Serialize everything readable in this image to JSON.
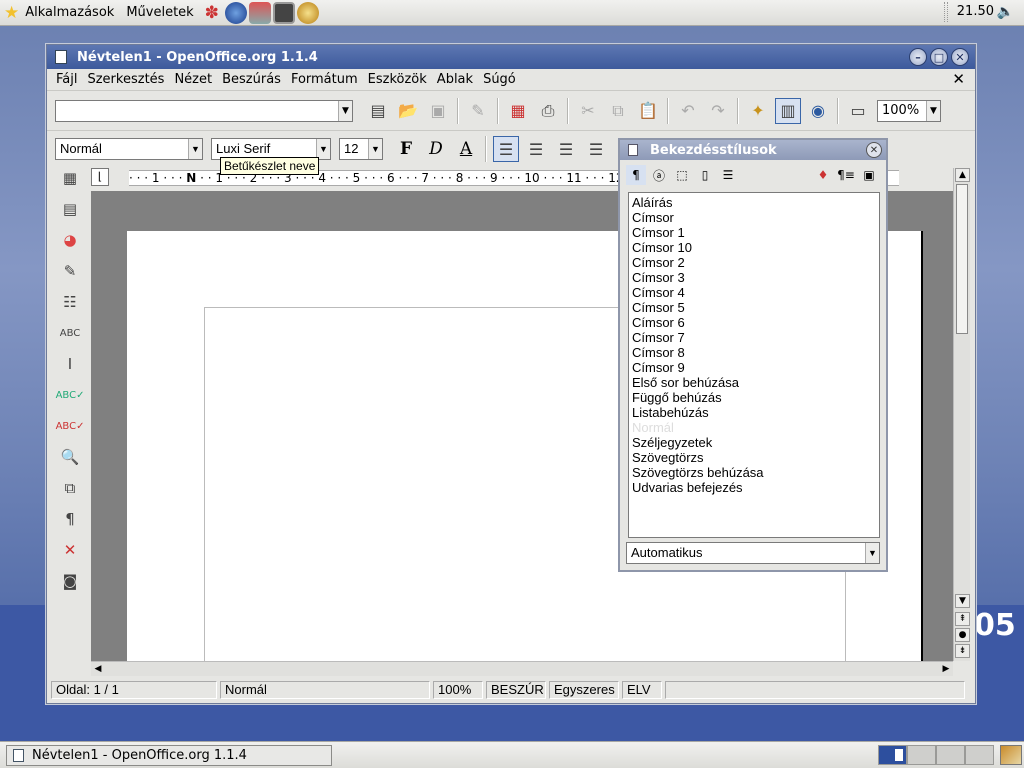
{
  "topbar": {
    "menu_apps": "Alkalmazások",
    "menu_actions": "Műveletek",
    "clock": "21.50"
  },
  "window": {
    "title": "Névtelen1 - OpenOffice.org 1.1.4",
    "menu": [
      "Fájl",
      "Szerkesztés",
      "Nézet",
      "Beszúrás",
      "Formátum",
      "Eszközök",
      "Ablak",
      "Súgó"
    ],
    "url_value": "",
    "zoom": "100%",
    "paragraph_style": "Normál",
    "font_name": "Luxi Serif",
    "font_size": "12",
    "bold_label": "F",
    "italic_label": "D",
    "underline_label": "A",
    "tooltip": "Betűkészlet neve",
    "ruler_text": "· · · 1 · · · 𝝢 · · 1 · · · 2 · · · 3 · · · 4 · · · 5 · · · 6 · · · 7 · · · 8 · · · 9 · · · 10 · · · 11 · · · 12 · · · 13 · · · 14 · · · 15 · · · 16 · · · 17 · · · 18 ·"
  },
  "status": {
    "page": "Oldal: 1 / 1",
    "style": "Normál",
    "zoom": "100%",
    "mode": "BESZÚR",
    "selection": "Egyszeres",
    "elv": "ELV"
  },
  "stylist": {
    "title": "Bekezdésstílusok",
    "items": [
      "Aláírás",
      "Címsor",
      "Címsor 1",
      "Címsor 10",
      "Címsor 2",
      "Címsor 3",
      "Címsor 4",
      "Címsor 5",
      "Címsor 6",
      "Címsor 7",
      "Címsor 8",
      "Címsor 9",
      "Első sor behúzása",
      "Függő behúzás",
      "Listabehúzás",
      "Normál",
      "Széljegyzetek",
      "Szövegtörzs",
      "Szövegtörzs behúzása",
      "Udvarias befejezés"
    ],
    "selected_index": 15,
    "filter": "Automatikus"
  },
  "taskbar": {
    "task_label": "Névtelen1 - OpenOffice.org 1.1.4"
  },
  "background_text": "05"
}
